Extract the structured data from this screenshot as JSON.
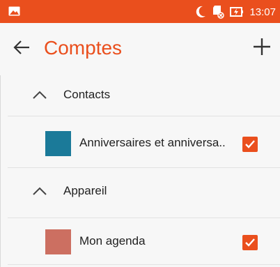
{
  "status_bar": {
    "time": "13:07",
    "icons": [
      "image-icon",
      "moon-icon",
      "sd-card-icon",
      "battery-charging-icon"
    ]
  },
  "toolbar": {
    "title": "Comptes",
    "back_icon": "arrow-left-icon",
    "add_icon": "plus-icon"
  },
  "groups": [
    {
      "label": "Contacts",
      "expanded": true,
      "items": [
        {
          "label": "Anniversaires et anniversa..",
          "color": "#1b7a99",
          "checked": true
        }
      ]
    },
    {
      "label": "Appareil",
      "expanded": true,
      "items": [
        {
          "label": "Mon agenda",
          "color": "#cc6f61",
          "checked": true
        }
      ]
    }
  ],
  "colors": {
    "accent": "#ea4f1d",
    "background": "#f7f7f7"
  }
}
